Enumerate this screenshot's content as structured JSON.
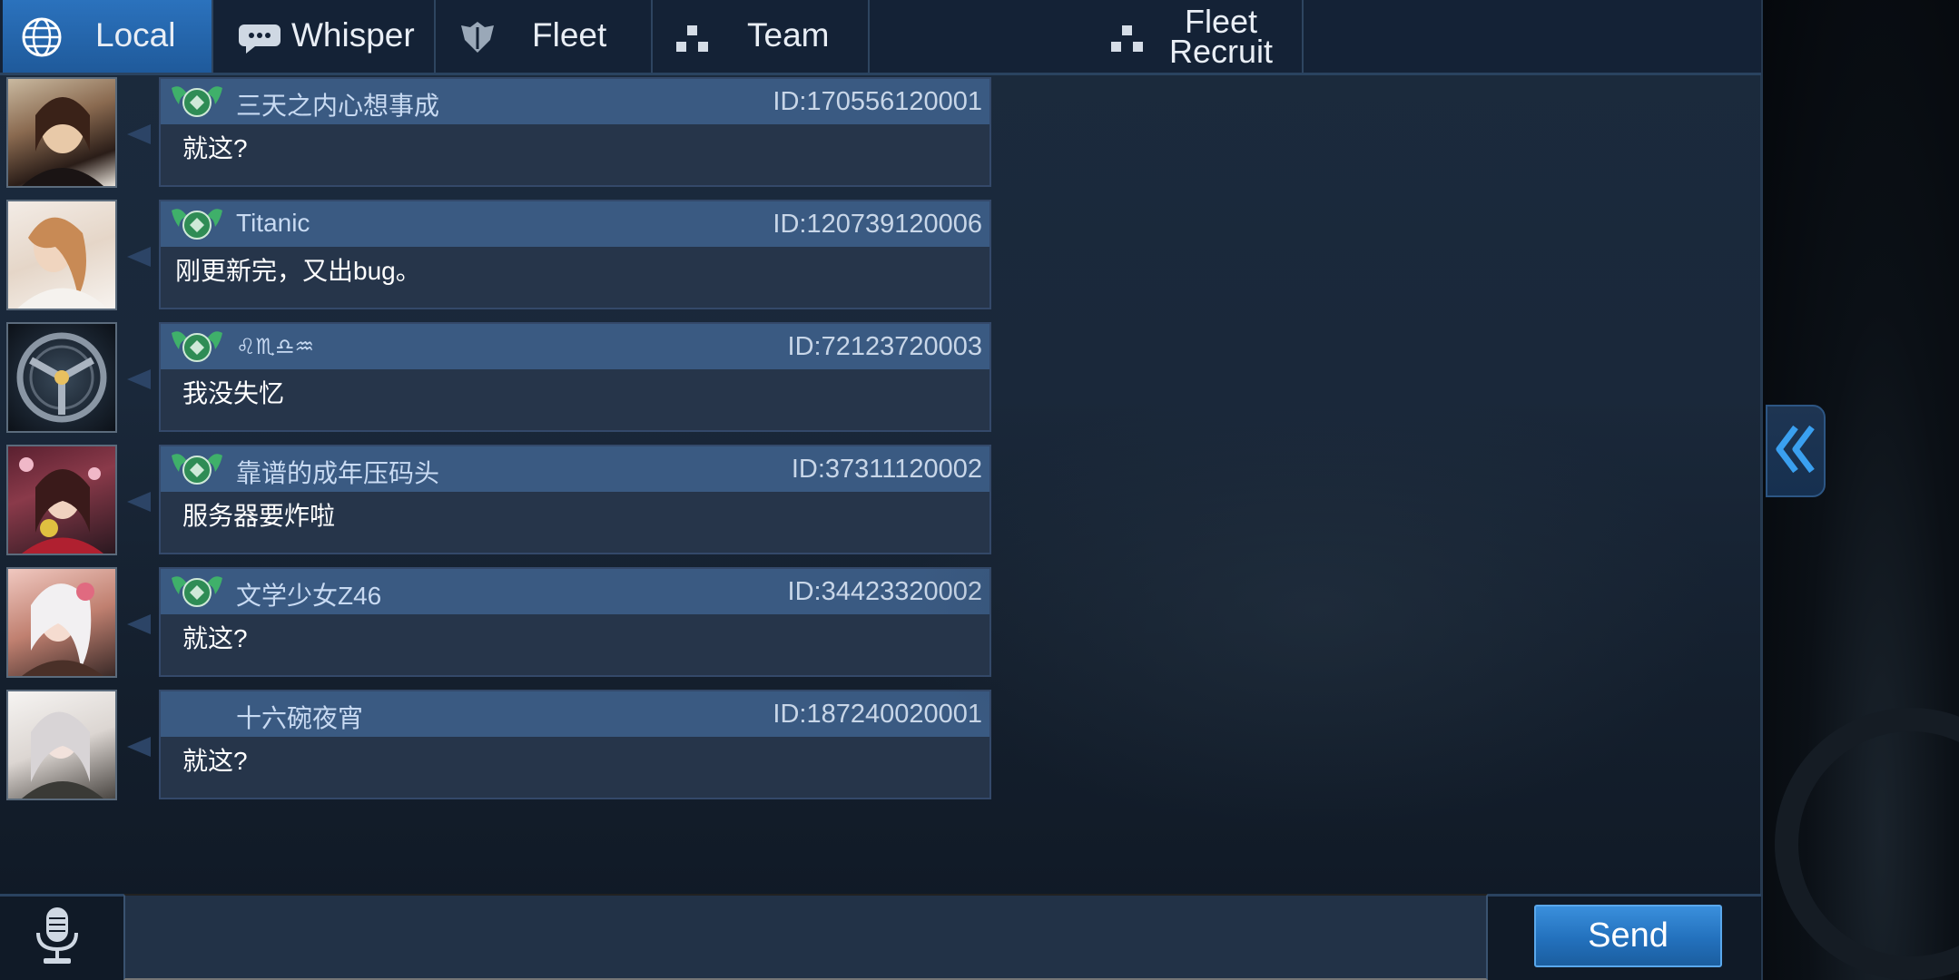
{
  "tabs": [
    {
      "label": "Local",
      "icon": "globe-icon",
      "active": true
    },
    {
      "label": "Whisper",
      "icon": "speech-bubble-icon",
      "active": false
    },
    {
      "label": "Fleet",
      "icon": "fleet-shield-icon",
      "active": false
    },
    {
      "label": "Team",
      "icon": "team-dots-icon",
      "active": false
    },
    {
      "label": "Fleet Recruit",
      "label_line1": "Fleet",
      "label_line2": "Recruit",
      "icon": "recruit-dots-icon",
      "active": false
    }
  ],
  "messages": [
    {
      "name": "三天之内心想事成",
      "id": "ID:170556120001",
      "text": "就这?",
      "badge": true,
      "avatar": "portrait"
    },
    {
      "name": "Titanic",
      "id": "ID:120739120006",
      "text": "刚更新完，又出bug。",
      "badge": true,
      "avatar": "portrait"
    },
    {
      "name": "♌♏♎♒",
      "id": "ID:72123720003",
      "text": "我没失忆",
      "badge": true,
      "avatar": "emblem"
    },
    {
      "name": "靠谱的成年压码头",
      "id": "ID:37311120002",
      "text": "服务器要炸啦",
      "badge": true,
      "avatar": "anime"
    },
    {
      "name": "文学少女Z46",
      "id": "ID:34423320002",
      "text": "就这?",
      "badge": true,
      "avatar": "anime"
    },
    {
      "name": "十六碗夜宵",
      "id": "ID:187240020001",
      "text": "就这?",
      "badge": false,
      "avatar": "anime"
    }
  ],
  "input": {
    "value": "",
    "placeholder": ""
  },
  "send_label": "Send",
  "icons": {
    "mic": "microphone-icon",
    "collapse": "double-chevron-left-icon"
  },
  "colors": {
    "accent": "#2b72bd",
    "panel": "#1a283a",
    "bubble_header": "#3a5a82",
    "send": "#2a7bc8"
  }
}
